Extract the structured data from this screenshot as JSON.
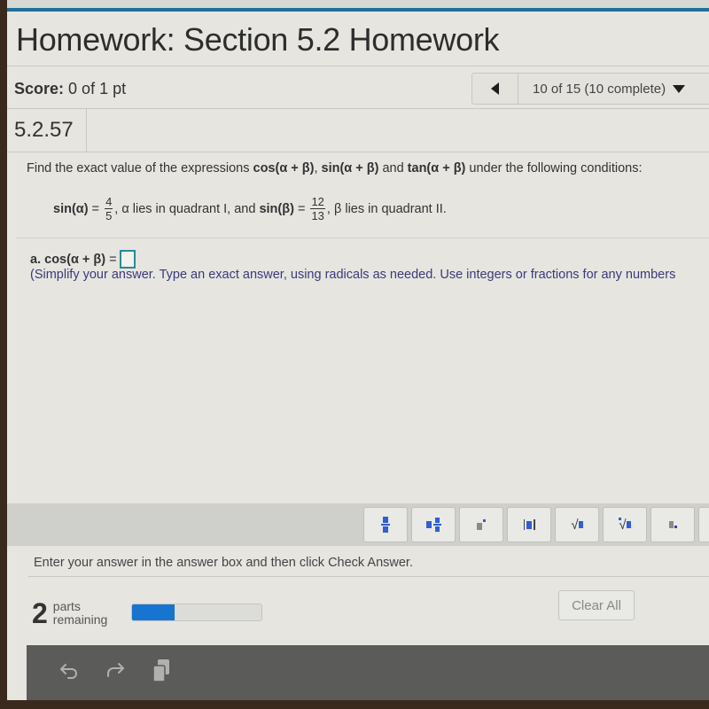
{
  "header": {
    "title": "Homework: Section 5.2 Homework",
    "score_label": "Score:",
    "score_value": "0 of 1 pt",
    "nav_label": "10 of 15 (10 complete)"
  },
  "question": {
    "number": "5.2.57",
    "prompt_prefix": "Find the exact value of the expressions ",
    "expr1": "cos(α + β)",
    "sep1": ", ",
    "expr2": "sin(α + β)",
    "sep2": " and ",
    "expr3": "tan(α + β)",
    "prompt_suffix": " under the following conditions:",
    "cond_sin_alpha": "sin(α)",
    "eq": " = ",
    "alpha_num": "4",
    "alpha_den": "5",
    "cond_mid": ", α lies in quadrant I, and ",
    "cond_sin_beta": "sin(β)",
    "beta_num": "12",
    "beta_den": "13",
    "cond_end": ", β lies in quadrant II."
  },
  "part_a": {
    "label": "a.",
    "expr": "cos(α + β)",
    "eq": " =",
    "answer_value": "",
    "instructions": "(Simplify your answer. Type an exact answer, using radicals as needed. Use integers or fractions for any numbers"
  },
  "palette": {
    "buttons": [
      "fraction",
      "mixed-number",
      "exponent",
      "absolute-value",
      "square-root",
      "nth-root",
      "subscript"
    ]
  },
  "footer": {
    "hint": "Enter your answer in the answer box and then click Check Answer.",
    "parts_count": "2",
    "parts_label_line1": "parts",
    "parts_label_line2": "remaining",
    "progress_fraction": 0.33,
    "clear_all": "Clear All"
  },
  "colors": {
    "accent": "#1f6f9a",
    "progress": "#1774d0",
    "palette_glyph": "#2f5ed6",
    "answer_box_border": "#2a8a9a"
  }
}
